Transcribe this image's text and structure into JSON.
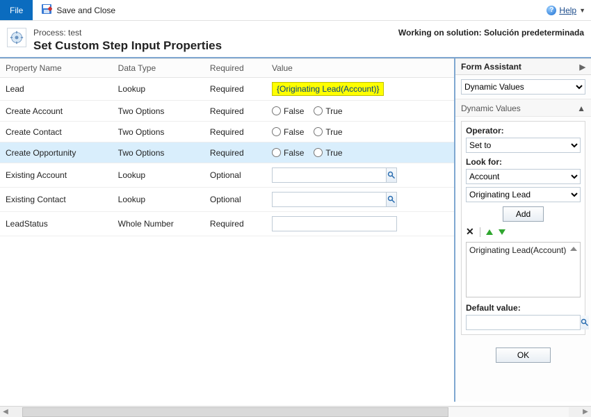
{
  "ribbon": {
    "file_label": "File",
    "save_and_close_label": "Save and Close",
    "help_label": "Help"
  },
  "header": {
    "process_prefix": "Process: ",
    "process_name": "test",
    "title": "Set Custom Step Input Properties",
    "working_on": "Working on solution: Solución predeterminada"
  },
  "grid": {
    "columns": {
      "property_name": "Property Name",
      "data_type": "Data Type",
      "required": "Required",
      "value": "Value"
    },
    "required_labels": {
      "required": "Required",
      "optional": "Optional"
    },
    "radio_labels": {
      "false": "False",
      "true": "True"
    },
    "rows": [
      {
        "name": "Lead",
        "data_type": "Lookup",
        "required": "Required",
        "value_type": "dynamic",
        "value_text": "{Originating Lead(Account)}"
      },
      {
        "name": "Create Account",
        "data_type": "Two Options",
        "required": "Required",
        "value_type": "radio",
        "selected": null
      },
      {
        "name": "Create Contact",
        "data_type": "Two Options",
        "required": "Required",
        "value_type": "radio",
        "selected": null
      },
      {
        "name": "Create Opportunity",
        "data_type": "Two Options",
        "required": "Required",
        "value_type": "radio",
        "selected": null,
        "selected_row": true
      },
      {
        "name": "Existing Account",
        "data_type": "Lookup",
        "required": "Optional",
        "value_type": "lookup",
        "value_text": ""
      },
      {
        "name": "Existing Contact",
        "data_type": "Lookup",
        "required": "Optional",
        "value_type": "lookup",
        "value_text": ""
      },
      {
        "name": "LeadStatus",
        "data_type": "Whole Number",
        "required": "Required",
        "value_type": "text",
        "value_text": ""
      }
    ]
  },
  "assistant": {
    "title": "Form Assistant",
    "top_select": "Dynamic Values",
    "section_title": "Dynamic Values",
    "operator_label": "Operator:",
    "operator_value": "Set to",
    "lookfor_label": "Look for:",
    "lookfor_entity": "Account",
    "lookfor_attribute": "Originating Lead",
    "add_label": "Add",
    "tokens": [
      "Originating Lead(Account)"
    ],
    "default_label": "Default value:",
    "default_value": "",
    "ok_label": "OK"
  }
}
